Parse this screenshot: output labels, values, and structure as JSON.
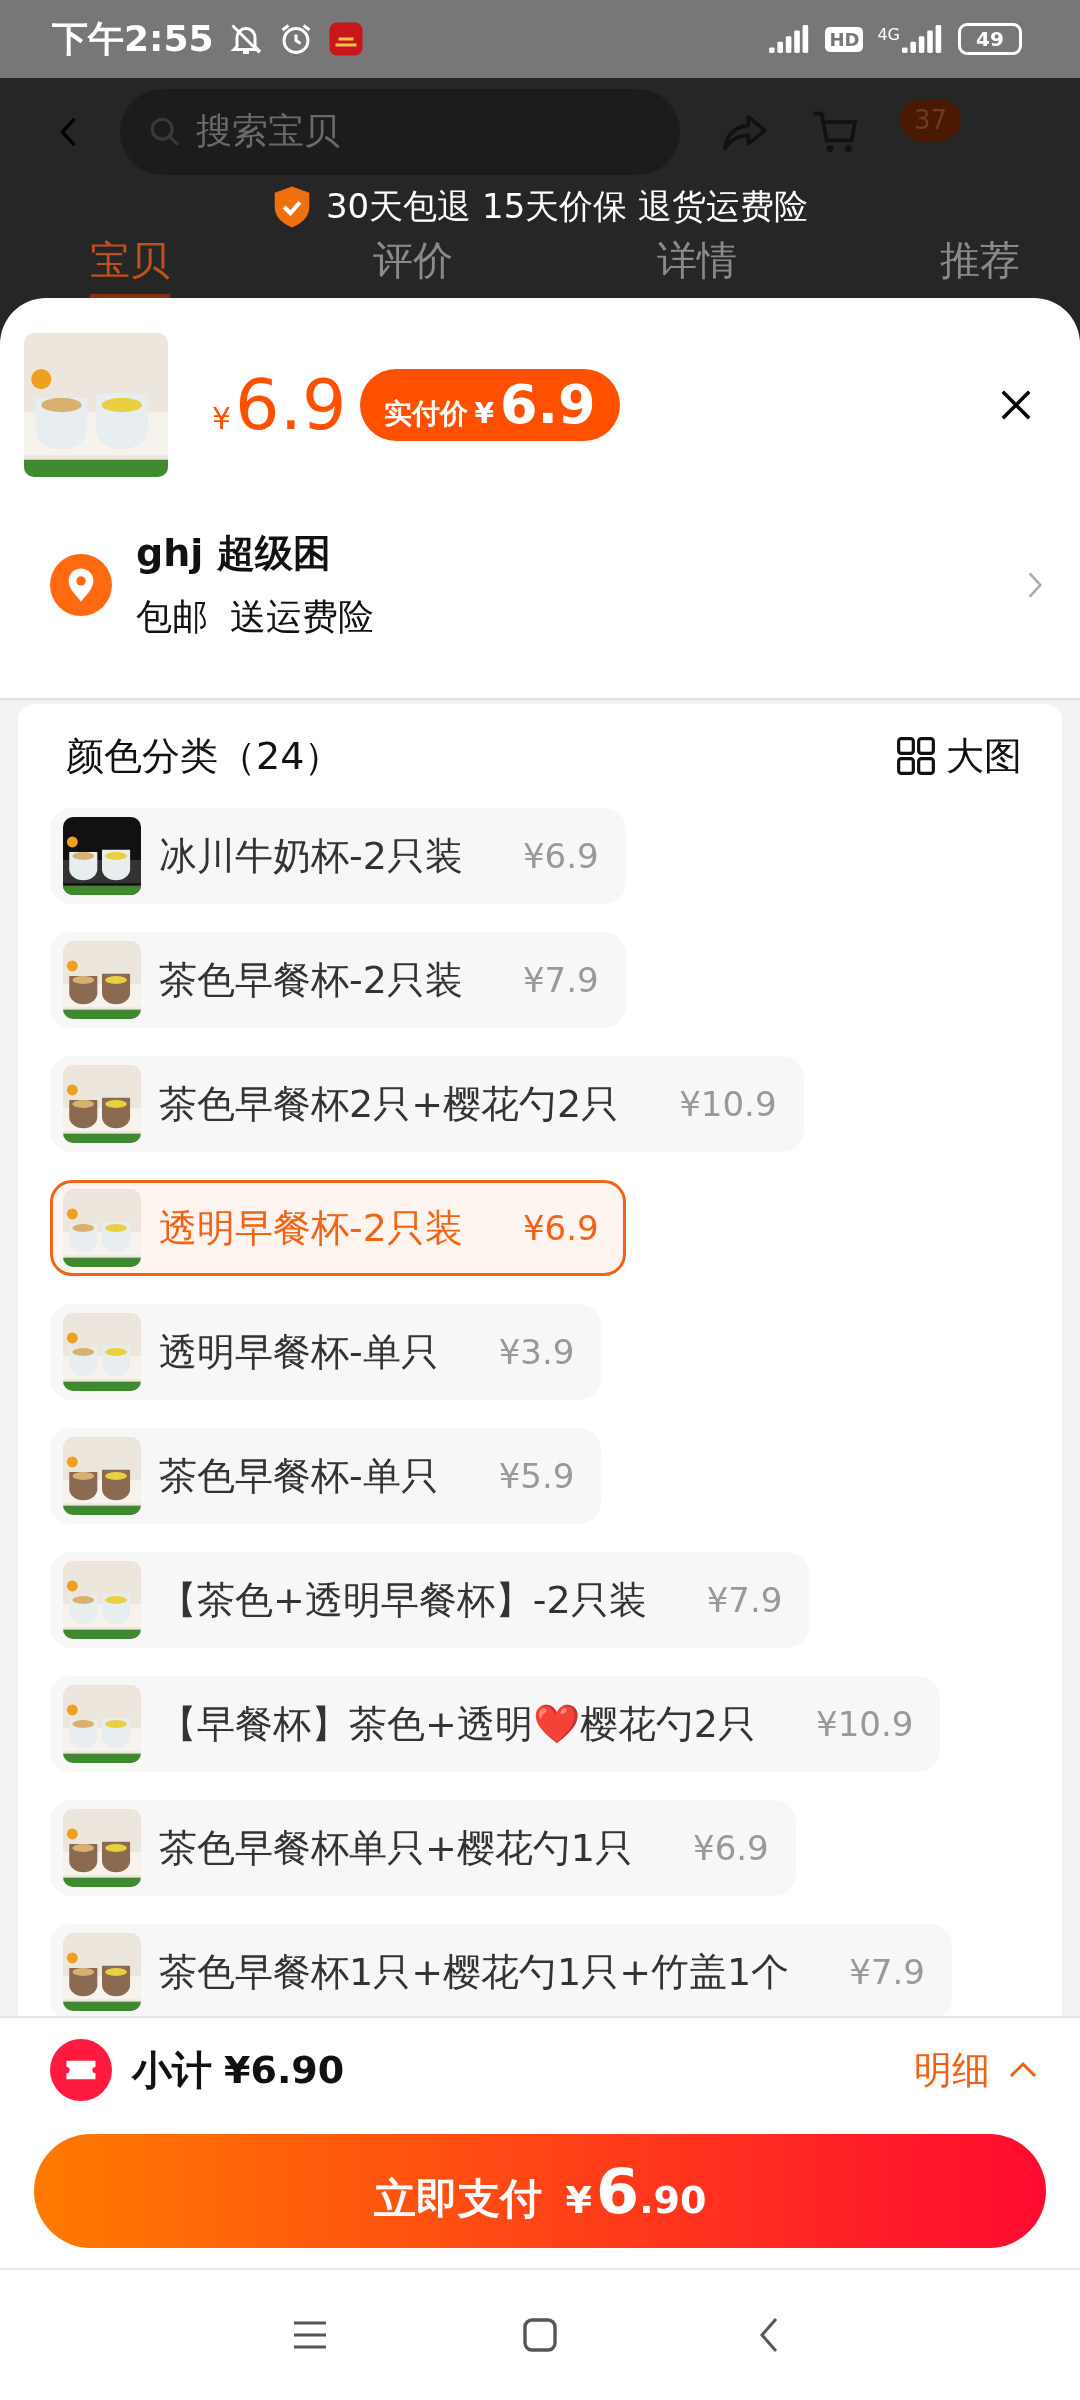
{
  "status_bar": {
    "time": "下午2:55",
    "network": "4G",
    "hd": "HD",
    "battery": "49"
  },
  "header": {
    "search": {
      "placeholder": "搜索宝贝"
    },
    "cart_badge": "37",
    "guarantee": "30天包退 15天价保 退货运费险",
    "tabs": [
      {
        "label": "宝贝",
        "selected": true
      },
      {
        "label": "评价",
        "selected": false
      },
      {
        "label": "详情",
        "selected": false
      },
      {
        "label": "推荐",
        "selected": false
      }
    ]
  },
  "sheet": {
    "product": {
      "currency": "¥",
      "price": "6.9",
      "paid_label": "实付价",
      "paid_currency": "¥",
      "paid_price": "6.9"
    },
    "address": {
      "name": "ghj 超级困",
      "shipping": [
        "包邮",
        "送运费险"
      ]
    },
    "options": {
      "title": "颜色分类（24）",
      "view_label": "大图",
      "items": [
        {
          "label": "冰川牛奶杯-2只装",
          "price": "¥6.9",
          "selected": false
        },
        {
          "label": "茶色早餐杯-2只装",
          "price": "¥7.9",
          "selected": false
        },
        {
          "label": "茶色早餐杯2只+樱花勺2只",
          "price": "¥10.9",
          "selected": false
        },
        {
          "label": "透明早餐杯-2只装",
          "price": "¥6.9",
          "selected": true
        },
        {
          "label": "透明早餐杯-单只",
          "price": "¥3.9",
          "selected": false
        },
        {
          "label": "茶色早餐杯-单只",
          "price": "¥5.9",
          "selected": false
        },
        {
          "label": "【茶色+透明早餐杯】-2只装",
          "price": "¥7.9",
          "selected": false
        },
        {
          "label": "【早餐杯】茶色+透明❤️樱花勺2只",
          "price": "¥10.9",
          "selected": false
        },
        {
          "label": "茶色早餐杯单只+樱花勺1只",
          "price": "¥6.9",
          "selected": false
        },
        {
          "label": "茶色早餐杯1只+樱花勺1只+竹盖1个",
          "price": "¥7.9",
          "selected": false
        }
      ]
    }
  },
  "footer": {
    "subtotal_label": "小计",
    "subtotal": "¥6.90",
    "details_label": "明细",
    "details_expanded": false,
    "pay_button": {
      "label": "立即支付",
      "currency": "¥",
      "integer": "6",
      "decimal": ".90"
    }
  }
}
